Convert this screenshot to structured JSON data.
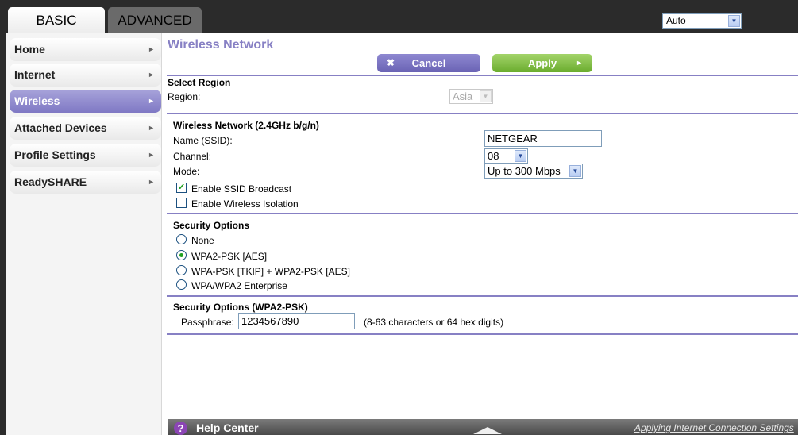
{
  "header": {
    "tabs": [
      {
        "label": "BASIC",
        "active": true
      },
      {
        "label": "ADVANCED",
        "active": false
      }
    ],
    "language_select": {
      "value": "Auto"
    }
  },
  "sidebar": {
    "items": [
      {
        "label": "Home",
        "active": false
      },
      {
        "label": "Internet",
        "active": false
      },
      {
        "label": "Wireless",
        "active": true
      },
      {
        "label": "Attached Devices",
        "active": false
      },
      {
        "label": "Profile Settings",
        "active": false
      },
      {
        "label": "ReadySHARE",
        "active": false
      }
    ]
  },
  "main": {
    "title": "Wireless Network",
    "cancel_label": "Cancel",
    "apply_label": "Apply",
    "region_section": {
      "title": "Select Region",
      "region_label": "Region:",
      "region_value": "Asia"
    },
    "wireless_section": {
      "title": "Wireless Network (2.4GHz b/g/n)",
      "ssid_label": "Name (SSID):",
      "ssid_value": "NETGEAR",
      "channel_label": "Channel:",
      "channel_value": "08",
      "mode_label": "Mode:",
      "mode_value": "Up to 300 Mbps",
      "ssid_broadcast_label": "Enable SSID Broadcast",
      "ssid_broadcast_checked": true,
      "isolation_label": "Enable Wireless Isolation",
      "isolation_checked": false
    },
    "security_section": {
      "title": "Security Options",
      "options": [
        {
          "label": "None",
          "selected": false
        },
        {
          "label": "WPA2-PSK [AES]",
          "selected": true
        },
        {
          "label": "WPA-PSK [TKIP] + WPA2-PSK [AES]",
          "selected": false
        },
        {
          "label": "WPA/WPA2 Enterprise",
          "selected": false
        }
      ]
    },
    "passphrase_section": {
      "title": "Security Options (WPA2-PSK)",
      "passphrase_label": "Passphrase:",
      "passphrase_value": "1234567890",
      "passphrase_hint": "(8-63 characters or 64 hex digits)"
    }
  },
  "help_bar": {
    "title": "Help Center",
    "link": "Applying Internet Connection Settings"
  },
  "colors": {
    "accent_purple": "#8780c4",
    "apply_green": "#6aac2e",
    "frame_dark": "#2b2b2b"
  }
}
